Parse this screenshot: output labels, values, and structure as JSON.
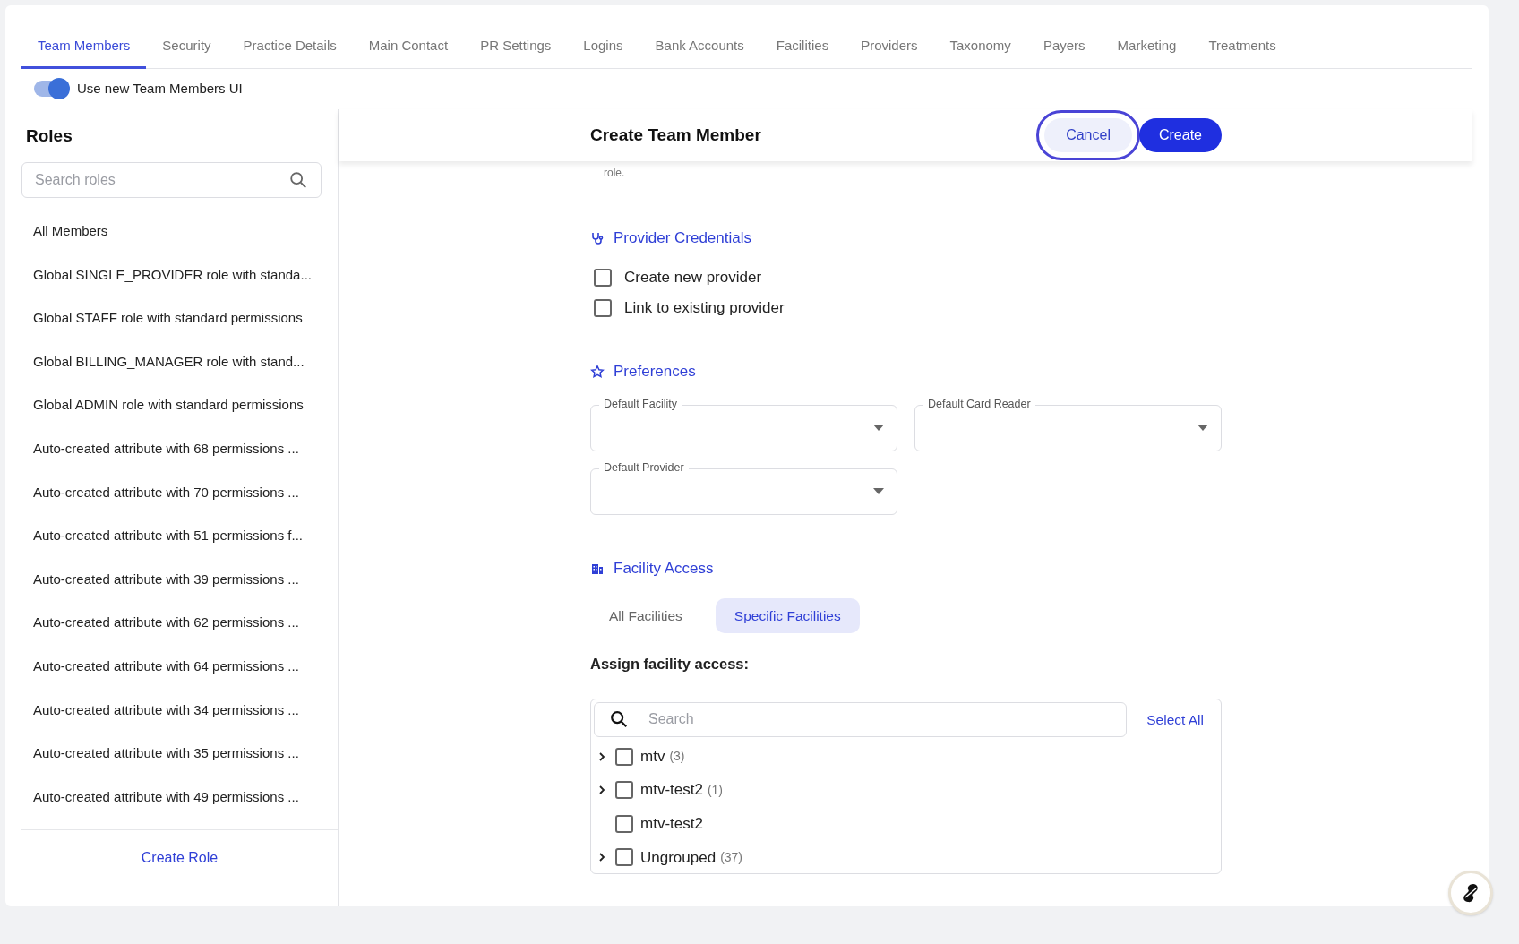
{
  "tabs": [
    {
      "label": "Team Members",
      "selected": true
    },
    {
      "label": "Security",
      "selected": false
    },
    {
      "label": "Practice Details",
      "selected": false
    },
    {
      "label": "Main Contact",
      "selected": false
    },
    {
      "label": "PR Settings",
      "selected": false
    },
    {
      "label": "Logins",
      "selected": false
    },
    {
      "label": "Bank Accounts",
      "selected": false
    },
    {
      "label": "Facilities",
      "selected": false
    },
    {
      "label": "Providers",
      "selected": false
    },
    {
      "label": "Taxonomy",
      "selected": false
    },
    {
      "label": "Payers",
      "selected": false
    },
    {
      "label": "Marketing",
      "selected": false
    },
    {
      "label": "Treatments",
      "selected": false
    }
  ],
  "toggle": {
    "label": "Use new Team Members UI",
    "on": true
  },
  "roles": {
    "title": "Roles",
    "search": {
      "placeholder": "Search roles"
    },
    "items": [
      "All Members",
      "Global SINGLE_PROVIDER role with standa...",
      "Global STAFF role with standard permissions",
      "Global BILLING_MANAGER role with stand...",
      "Global ADMIN role with standard permissions",
      "Auto-created attribute with 68 permissions ...",
      "Auto-created attribute with 70 permissions ...",
      "Auto-created attribute with 51 permissions f...",
      "Auto-created attribute with 39 permissions ...",
      "Auto-created attribute with 62 permissions ...",
      "Auto-created attribute with 64 permissions ...",
      "Auto-created attribute with 34 permissions ...",
      "Auto-created attribute with 35 permissions ...",
      "Auto-created attribute with 49 permissions ..."
    ],
    "create_button": "Create Role"
  },
  "form": {
    "title": "Create Team Member",
    "buttons": [
      {
        "label": "Cancel",
        "kind": "secondary",
        "focused": true
      },
      {
        "label": "Create",
        "kind": "primary",
        "focused": false
      }
    ],
    "intro_tail": "role.",
    "sections": [
      {
        "kind": "checkboxes",
        "title": "Provider Credentials",
        "items": [
          {
            "label": "Create new provider",
            "checked": false
          },
          {
            "label": "Link to existing provider",
            "checked": false
          }
        ]
      },
      {
        "kind": "selects",
        "title": "Preferences",
        "fields": [
          {
            "label": "Default Facility"
          },
          {
            "label": "Default Card Reader"
          },
          {
            "label": "Default Provider"
          }
        ]
      },
      {
        "kind": "facility_access",
        "title": "Facility Access",
        "segments": [
          {
            "label": "All Facilities",
            "selected": false
          },
          {
            "label": "Specific Facilities",
            "selected": true
          }
        ],
        "assign_label": "Assign facility access:",
        "search": {
          "placeholder": "Search"
        },
        "select_all": "Select All",
        "tree": [
          {
            "label": "mtv",
            "count": "(3)",
            "checked": false,
            "expandable": true
          },
          {
            "label": "mtv-test2",
            "count": "(1)",
            "checked": false,
            "expandable": true
          },
          {
            "label": "mtv-test2",
            "checked": false,
            "expandable": false
          },
          {
            "label": "Ungrouped",
            "count": "(37)",
            "checked": false,
            "expandable": true
          }
        ]
      }
    ]
  }
}
